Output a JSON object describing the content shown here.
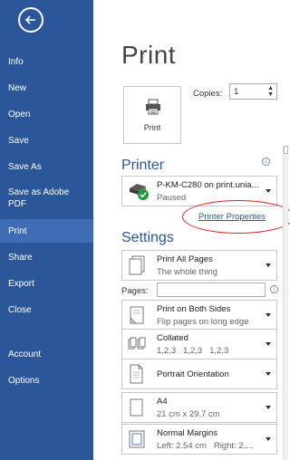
{
  "sidebar": {
    "back_icon": "arrow-left-icon",
    "items": [
      {
        "label": "Info"
      },
      {
        "label": "New"
      },
      {
        "label": "Open"
      },
      {
        "label": "Save"
      },
      {
        "label": "Save As"
      },
      {
        "label": "Save as Adobe PDF"
      },
      {
        "label": "Print",
        "active": true
      },
      {
        "label": "Share"
      },
      {
        "label": "Export"
      },
      {
        "label": "Close"
      },
      {
        "label": "Account"
      },
      {
        "label": "Options"
      }
    ],
    "bg_color": "#2b579a",
    "active_color": "#3e6db5"
  },
  "main": {
    "title": "Print",
    "print_button": {
      "label": "Print"
    },
    "copies": {
      "label": "Copies:",
      "value": "1"
    },
    "printer": {
      "section_title": "Printer",
      "name": "P-KM-C280 on print.unia...",
      "status": "Paused",
      "properties_link": "Printer Properties"
    },
    "settings": {
      "section_title": "Settings",
      "print_range": {
        "main": "Print All Pages",
        "sub": "The whole thing"
      },
      "pages_label": "Pages:",
      "duplex": {
        "main": "Print on Both Sides",
        "sub": "Flip pages on long edge"
      },
      "collation": {
        "main": "Collated",
        "sub": "1,2,3   1,2,3   1,2,3"
      },
      "orientation": {
        "main": "Portrait Orientation"
      },
      "paper": {
        "main": "A4",
        "sub": "21 cm x 29.7 cm"
      },
      "margins": {
        "main": "Normal Margins",
        "sub": "Left: 2.54 cm   Right: 2...."
      }
    }
  },
  "accent_color": "#2b579a",
  "annotation_color": "#e02020"
}
